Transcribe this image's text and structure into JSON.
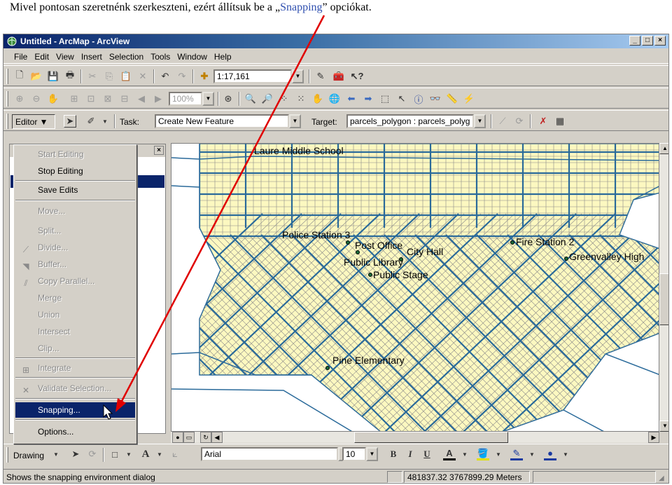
{
  "caption": {
    "before": "Mivel pontosan szeretnénk szerkeszteni, ezért állítsuk be a ",
    "quote_open": "„",
    "highlight": "Snapping",
    "quote_close": "”",
    "after": " opciókat."
  },
  "window": {
    "title": "Untitled - ArcMap - ArcView",
    "controls": [
      "_",
      "□",
      "×"
    ]
  },
  "menubar": [
    "File",
    "Edit",
    "View",
    "Insert",
    "Selection",
    "Tools",
    "Window",
    "Help"
  ],
  "standard_toolbar": {
    "scale_value": "1:17,161"
  },
  "tools_toolbar": {
    "zoom_value": "100%"
  },
  "editor_toolbar": {
    "editor_label": "Editor ▼",
    "task_label": "Task:",
    "task_value": "Create New Feature",
    "target_label": "Target:",
    "target_value": "parcels_polygon : parcels_polyg"
  },
  "editor_menu": {
    "items": [
      {
        "label": "Start Editing",
        "enabled": false,
        "icon": ""
      },
      {
        "label": "Stop Editing",
        "enabled": true,
        "icon": ""
      },
      {
        "label": "Save Edits",
        "enabled": true,
        "icon": ""
      },
      {
        "label": "Move...",
        "enabled": false,
        "icon": ""
      },
      {
        "label": "Split...",
        "enabled": false,
        "icon": ""
      },
      {
        "label": "Divide...",
        "enabled": false,
        "icon": "divide-icon"
      },
      {
        "label": "Buffer...",
        "enabled": false,
        "icon": "buffer-icon"
      },
      {
        "label": "Copy Parallel...",
        "enabled": false,
        "icon": "copy-parallel-icon"
      },
      {
        "label": "Merge",
        "enabled": false,
        "icon": ""
      },
      {
        "label": "Union",
        "enabled": false,
        "icon": ""
      },
      {
        "label": "Intersect",
        "enabled": false,
        "icon": ""
      },
      {
        "label": "Clip...",
        "enabled": false,
        "icon": ""
      },
      {
        "label": "Integrate",
        "enabled": false,
        "icon": "integrate-icon"
      },
      {
        "label": "Validate Selection...",
        "enabled": false,
        "icon": "validate-icon"
      },
      {
        "label": "Snapping...",
        "enabled": true,
        "icon": ""
      },
      {
        "label": "Options...",
        "enabled": true,
        "icon": ""
      }
    ]
  },
  "map": {
    "labels": {
      "school": "Laure Middle School",
      "police": "Police Station 3",
      "post": "Post Office",
      "cityhall": "City Hall",
      "library": "Public Library",
      "stage": "Public Stage",
      "fire": "Fire Station 2",
      "highschool": "Greenvalley High",
      "elementary": "Pine Elementary"
    },
    "colors": {
      "parcel_fill": "#fcf8c0",
      "street": "#2a6a9a",
      "outline": "#8a8a8a"
    }
  },
  "drawing_toolbar": {
    "label": "Drawing",
    "font_value": "Arial",
    "size_value": "10",
    "bold": "B",
    "italic": "I",
    "underline": "U"
  },
  "statusbar": {
    "message": "Shows the snapping environment dialog",
    "coords": "481837.32  3767899.29 Meters"
  },
  "annotation": {
    "arrow_color": "#e00000"
  }
}
